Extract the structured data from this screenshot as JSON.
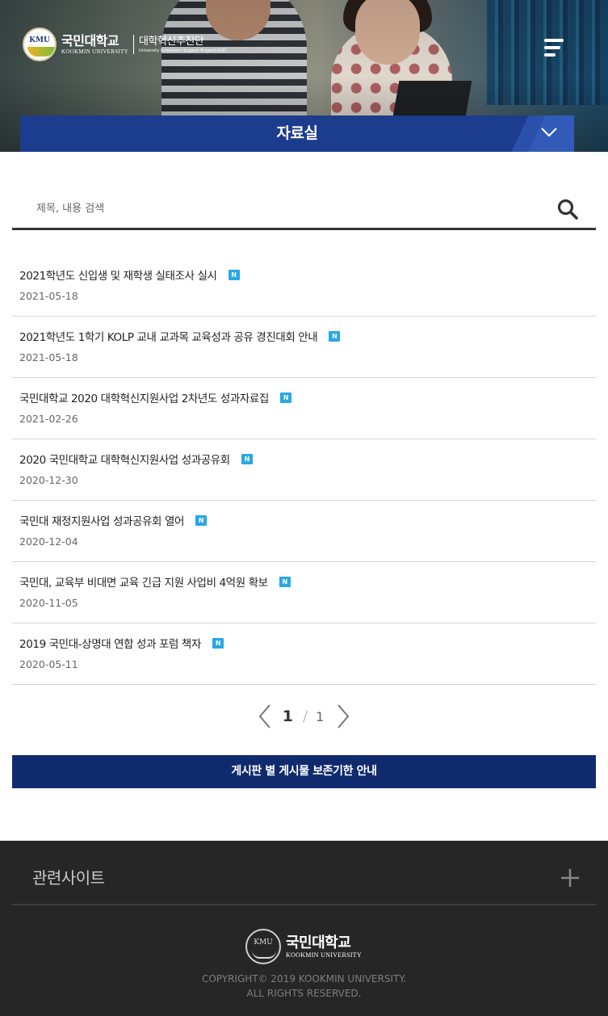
{
  "header": {
    "logo_mark": "KMU",
    "university_ko": "국민대학교",
    "university_en": "KOOKMIN UNIVERSITY",
    "unit_ko": "대학혁신추진단",
    "unit_en": "University Innovation Support Project(UISP)",
    "page_title": "자료실"
  },
  "search": {
    "placeholder": "제목, 내용 검색",
    "value": ""
  },
  "posts": [
    {
      "title": "2021학년도 신입생 및 재학생 실태조사 실시",
      "date": "2021-05-18",
      "badge": "N"
    },
    {
      "title": "2021학년도 1학기 KOLP 교내 교과목 교육성과 공유 경진대회 안내",
      "date": "2021-05-18",
      "badge": "N"
    },
    {
      "title": "국민대학교 2020 대학혁신지원사업 2차년도 성과자료집",
      "date": "2021-02-26",
      "badge": "N"
    },
    {
      "title": "2020 국민대학교 대학혁신지원사업 성과공유회",
      "date": "2020-12-30",
      "badge": "N"
    },
    {
      "title": "국민대 재정지원사업 성과공유회 열어",
      "date": "2020-12-04",
      "badge": "N"
    },
    {
      "title": "국민대, 교육부 비대면 교육 긴급 지원 사업비 4억원 확보",
      "date": "2020-11-05",
      "badge": "N"
    },
    {
      "title": "2019 국민대-상명대 연합 성과 포럼 책자",
      "date": "2020-05-11",
      "badge": "N"
    }
  ],
  "pagination": {
    "current": "1",
    "separator": "/",
    "total": "1"
  },
  "notice_button": "게시판 별 게시물 보존기한 안내",
  "footer": {
    "related_sites": "관련사이트",
    "logo_mark": "KMU",
    "university_ko": "국민대학교",
    "university_en": "KOOKMIN UNIVERSITY",
    "copyright_line1": "COPYRIGHT© 2019 KOOKMIN UNIVERSITY.",
    "copyright_line2": "ALL RIGHTS RESERVED."
  },
  "colors": {
    "title_bar": "#1c3c8e",
    "notice_button": "#0f2b6d",
    "new_badge": "#2aa7e6",
    "footer_bg": "#262626"
  },
  "icons": {
    "menu": "hamburger-icon",
    "dropdown": "chevron-down-icon",
    "search": "search-icon",
    "prev": "chevron-left-icon",
    "next": "chevron-right-icon",
    "expand": "plus-icon"
  }
}
